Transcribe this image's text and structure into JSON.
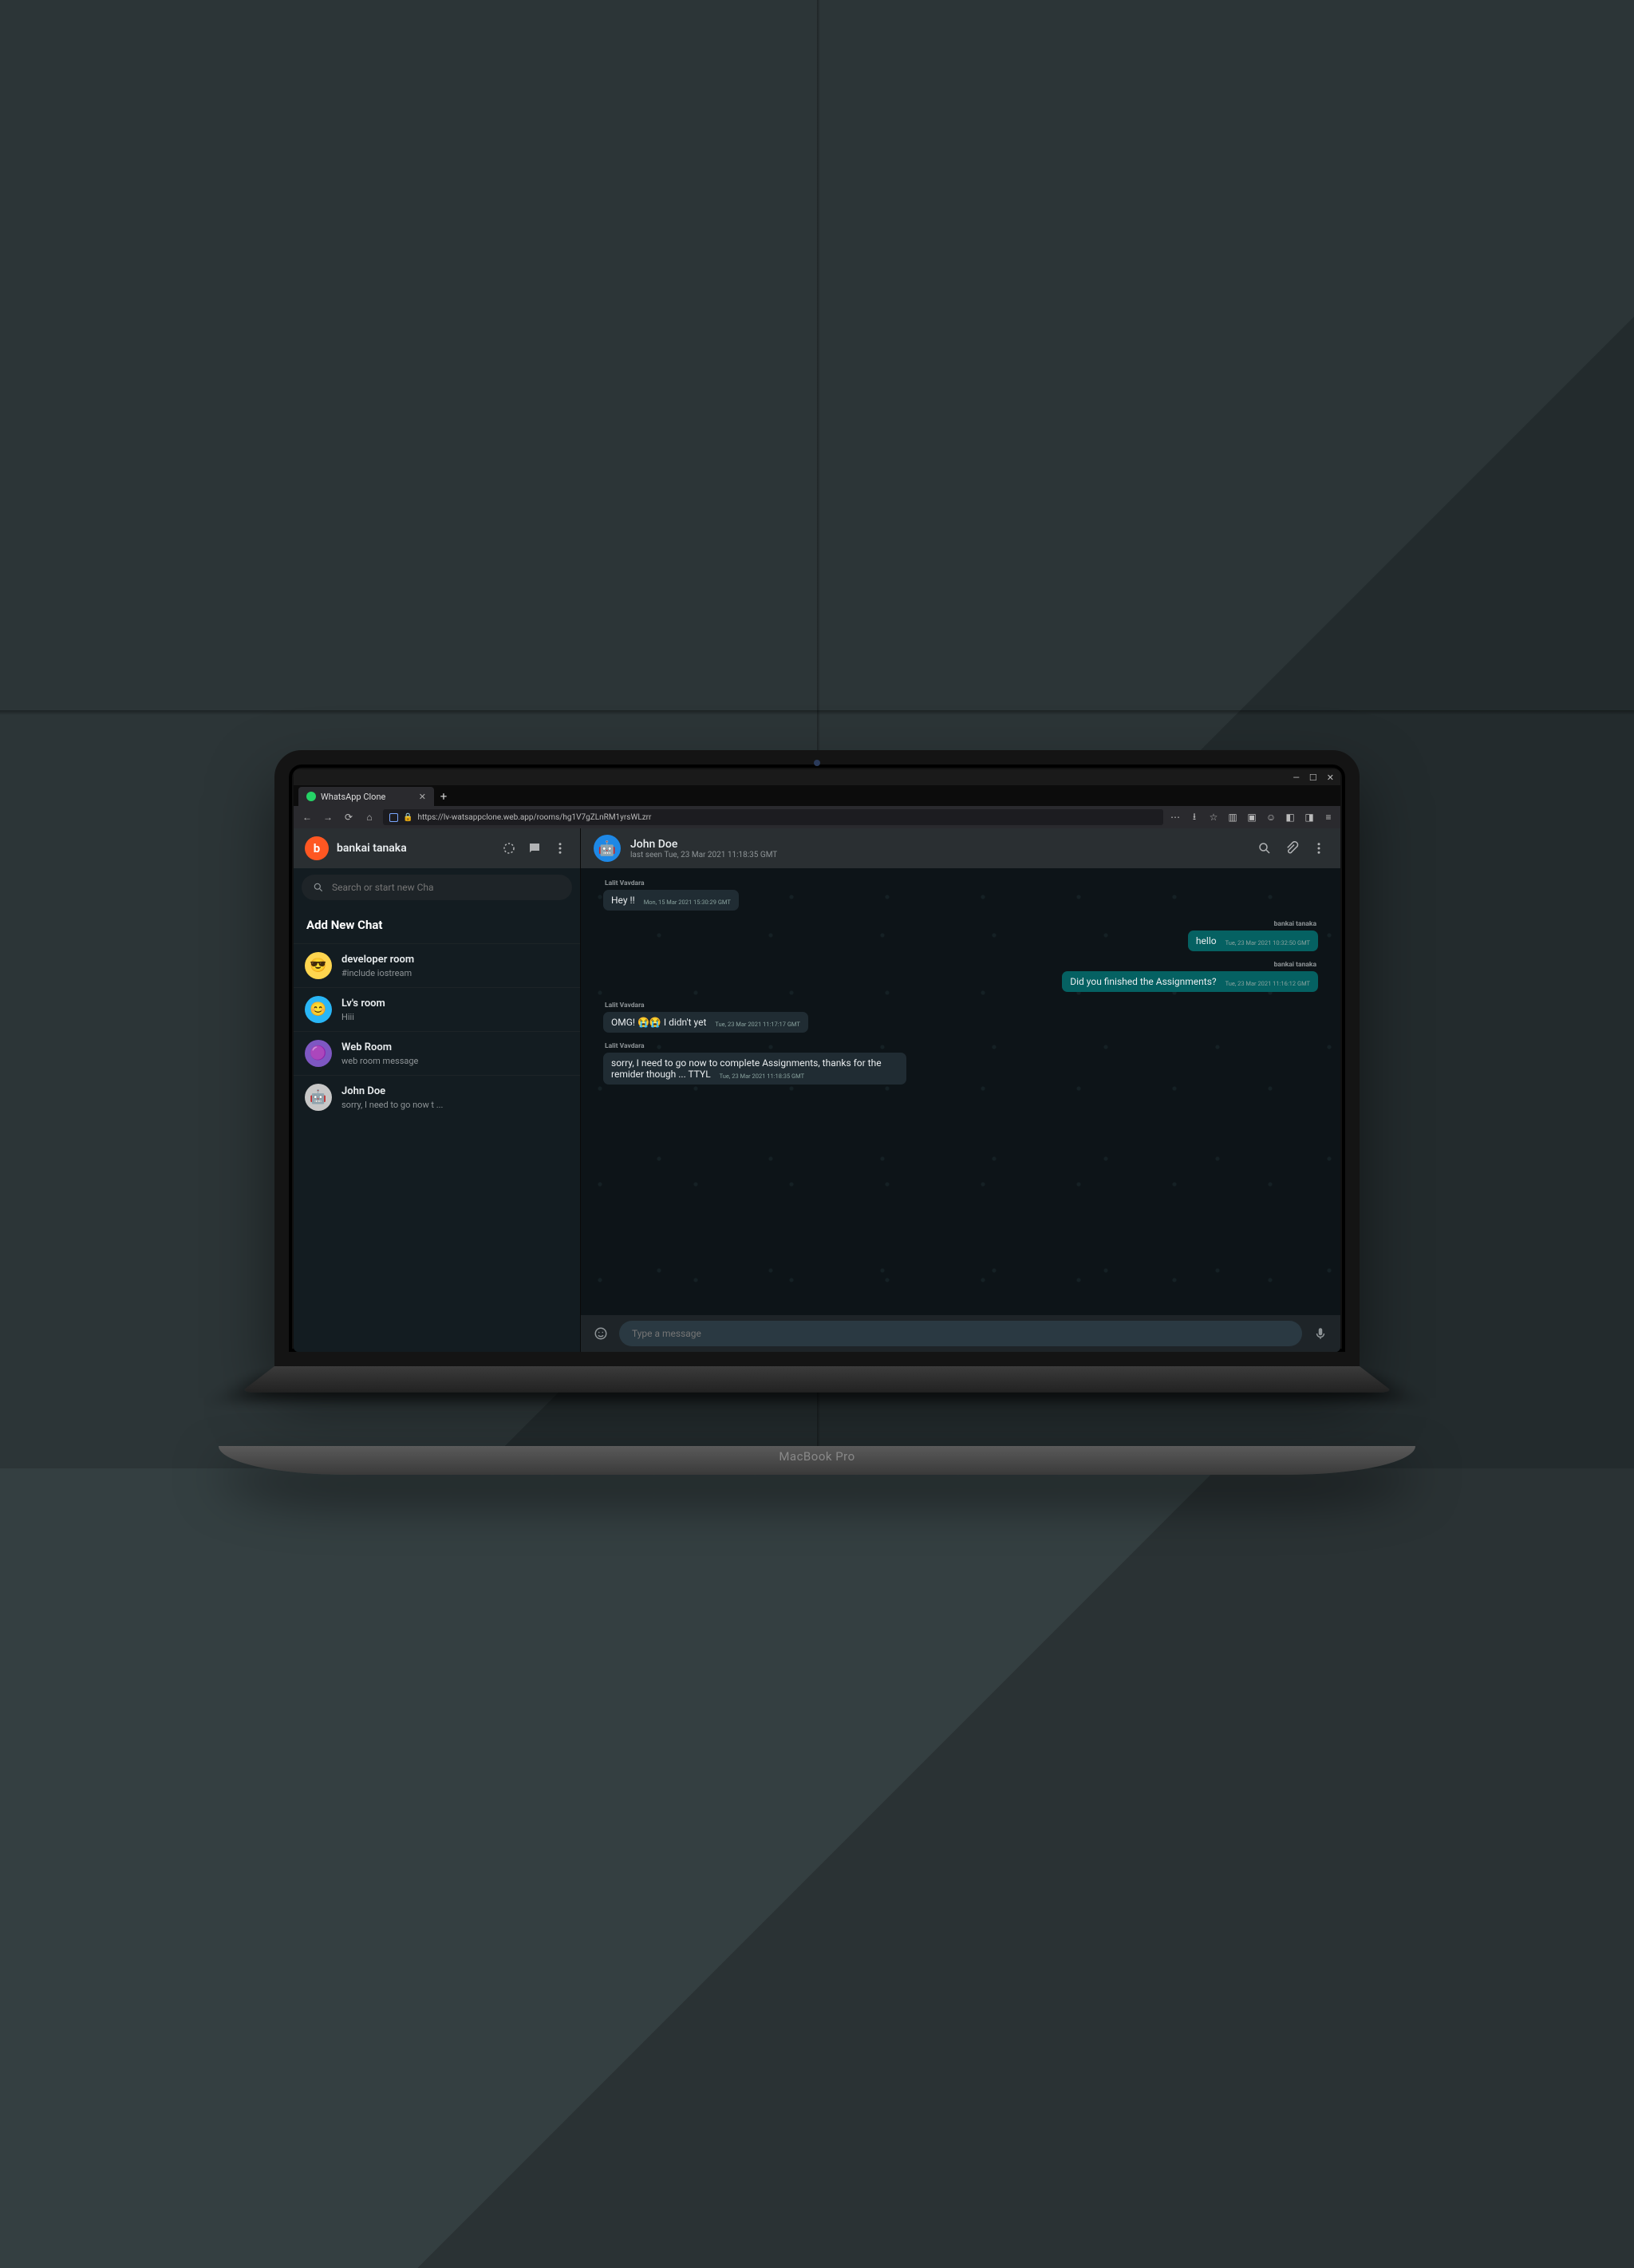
{
  "browser": {
    "tab_title": "WhatsApp Clone",
    "url": "https://lv-watsappclone.web.app/rooms/hg1V7gZLnRM1yrsWLzrr",
    "window_controls": {
      "min": "—",
      "max": "☐",
      "close": "✕"
    },
    "newtab": "+"
  },
  "sidebar": {
    "user_name": "bankai tanaka",
    "user_initial": "b",
    "search_placeholder": "Search or start new Cha",
    "add_new_label": "Add New Chat",
    "chats": [
      {
        "name": "developer room",
        "preview": "#include iostream",
        "face": "😎"
      },
      {
        "name": "Lv's room",
        "preview": "Hiii",
        "face": "😊"
      },
      {
        "name": "Web Room",
        "preview": "web room message",
        "face": "🟣"
      },
      {
        "name": "John Doe",
        "preview": "sorry, I need to go now t ...",
        "face": "🤖"
      }
    ]
  },
  "chat": {
    "contact_name": "John Doe",
    "last_seen": "last seen Tue, 23 Mar 2021 11:18:35 GMT",
    "messages": [
      {
        "from": "Lalit Vavdara",
        "side": "in",
        "text": "Hey !!",
        "ts": "Mon, 15 Mar 2021 15:30:29 GMT"
      },
      {
        "from": "bankai tanaka",
        "side": "out",
        "text": "hello",
        "ts": "Tue, 23 Mar 2021 10:32:50 GMT"
      },
      {
        "from": "bankai tanaka",
        "side": "out",
        "text": "Did you finished the Assignments?",
        "ts": "Tue, 23 Mar 2021 11:16:12 GMT"
      },
      {
        "from": "Lalit Vavdara",
        "side": "in",
        "text": "OMG! 😭😭 I didn't yet",
        "ts": "Tue, 23 Mar 2021 11:17:17 GMT"
      },
      {
        "from": "Lalit Vavdara",
        "side": "in",
        "text": "sorry, I need to go now to complete Assignments, thanks for the remider though ... TTYL",
        "ts": "Tue, 23 Mar 2021 11:18:35 GMT"
      }
    ],
    "composer_placeholder": "Type a message"
  },
  "laptop_label": "MacBook Pro"
}
